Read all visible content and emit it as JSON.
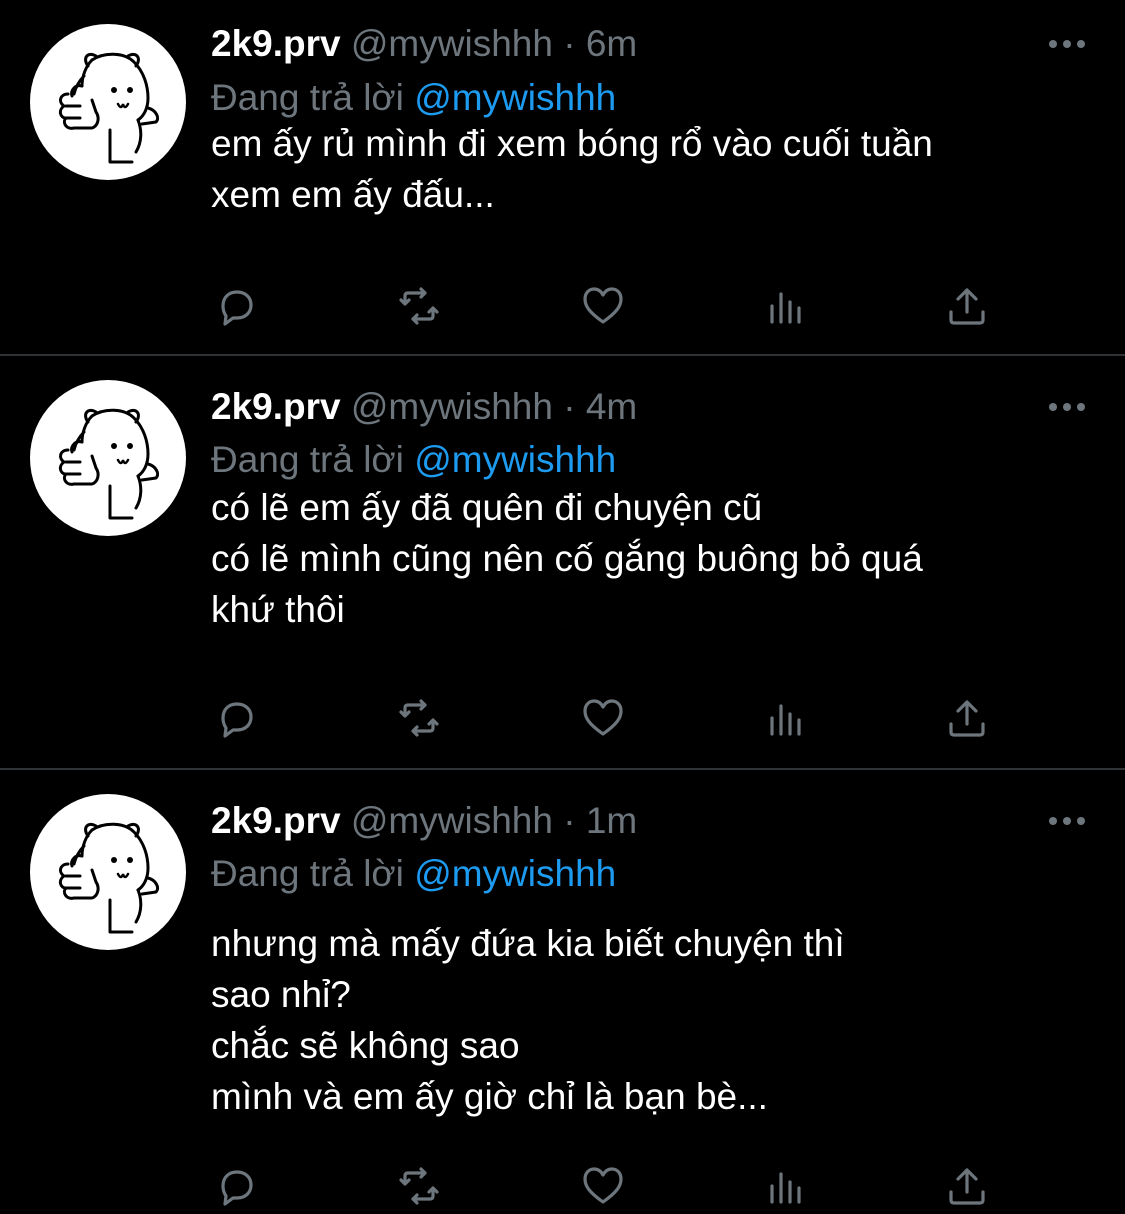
{
  "tweets": [
    {
      "name": "2k9.prv",
      "handle": "@mywishhh",
      "dot": "·",
      "time": "6m",
      "reply_prefix": "Đang trả lời",
      "reply_to": "@mywishhh",
      "lines": [
        "em ấy rủ mình đi xem bóng rổ vào cuối tuần",
        "xem em ấy đấu..."
      ]
    },
    {
      "name": "2k9.prv",
      "handle": "@mywishhh",
      "dot": "·",
      "time": "4m",
      "reply_prefix": "Đang trả lời",
      "reply_to": "@mywishhh",
      "lines": [
        "có lẽ em ấy đã quên đi chuyện cũ",
        "có lẽ mình cũng nên cố gắng buông bỏ quá",
        "khứ thôi"
      ]
    },
    {
      "name": "2k9.prv",
      "handle": "@mywishhh",
      "dot": "·",
      "time": "1m",
      "reply_prefix": "Đang trả lời",
      "reply_to": "@mywishhh",
      "lines": [
        "nhưng mà mấy đứa kia biết chuyện thì",
        "sao nhỉ?",
        "chắc sẽ không sao",
        "mình và em ấy giờ chỉ là bạn bè..."
      ]
    }
  ],
  "icons": {
    "avatar": "bear-thumbs-up-icon",
    "more": "more-options-icon",
    "reply": "reply-icon",
    "retweet": "retweet-icon",
    "like": "heart-icon",
    "analytics": "analytics-icon",
    "share": "share-icon"
  },
  "colors": {
    "background": "#000000",
    "text": "#ffffff",
    "muted": "#6e767d",
    "mention": "#1d9bf0",
    "divider": "#2f3336"
  }
}
